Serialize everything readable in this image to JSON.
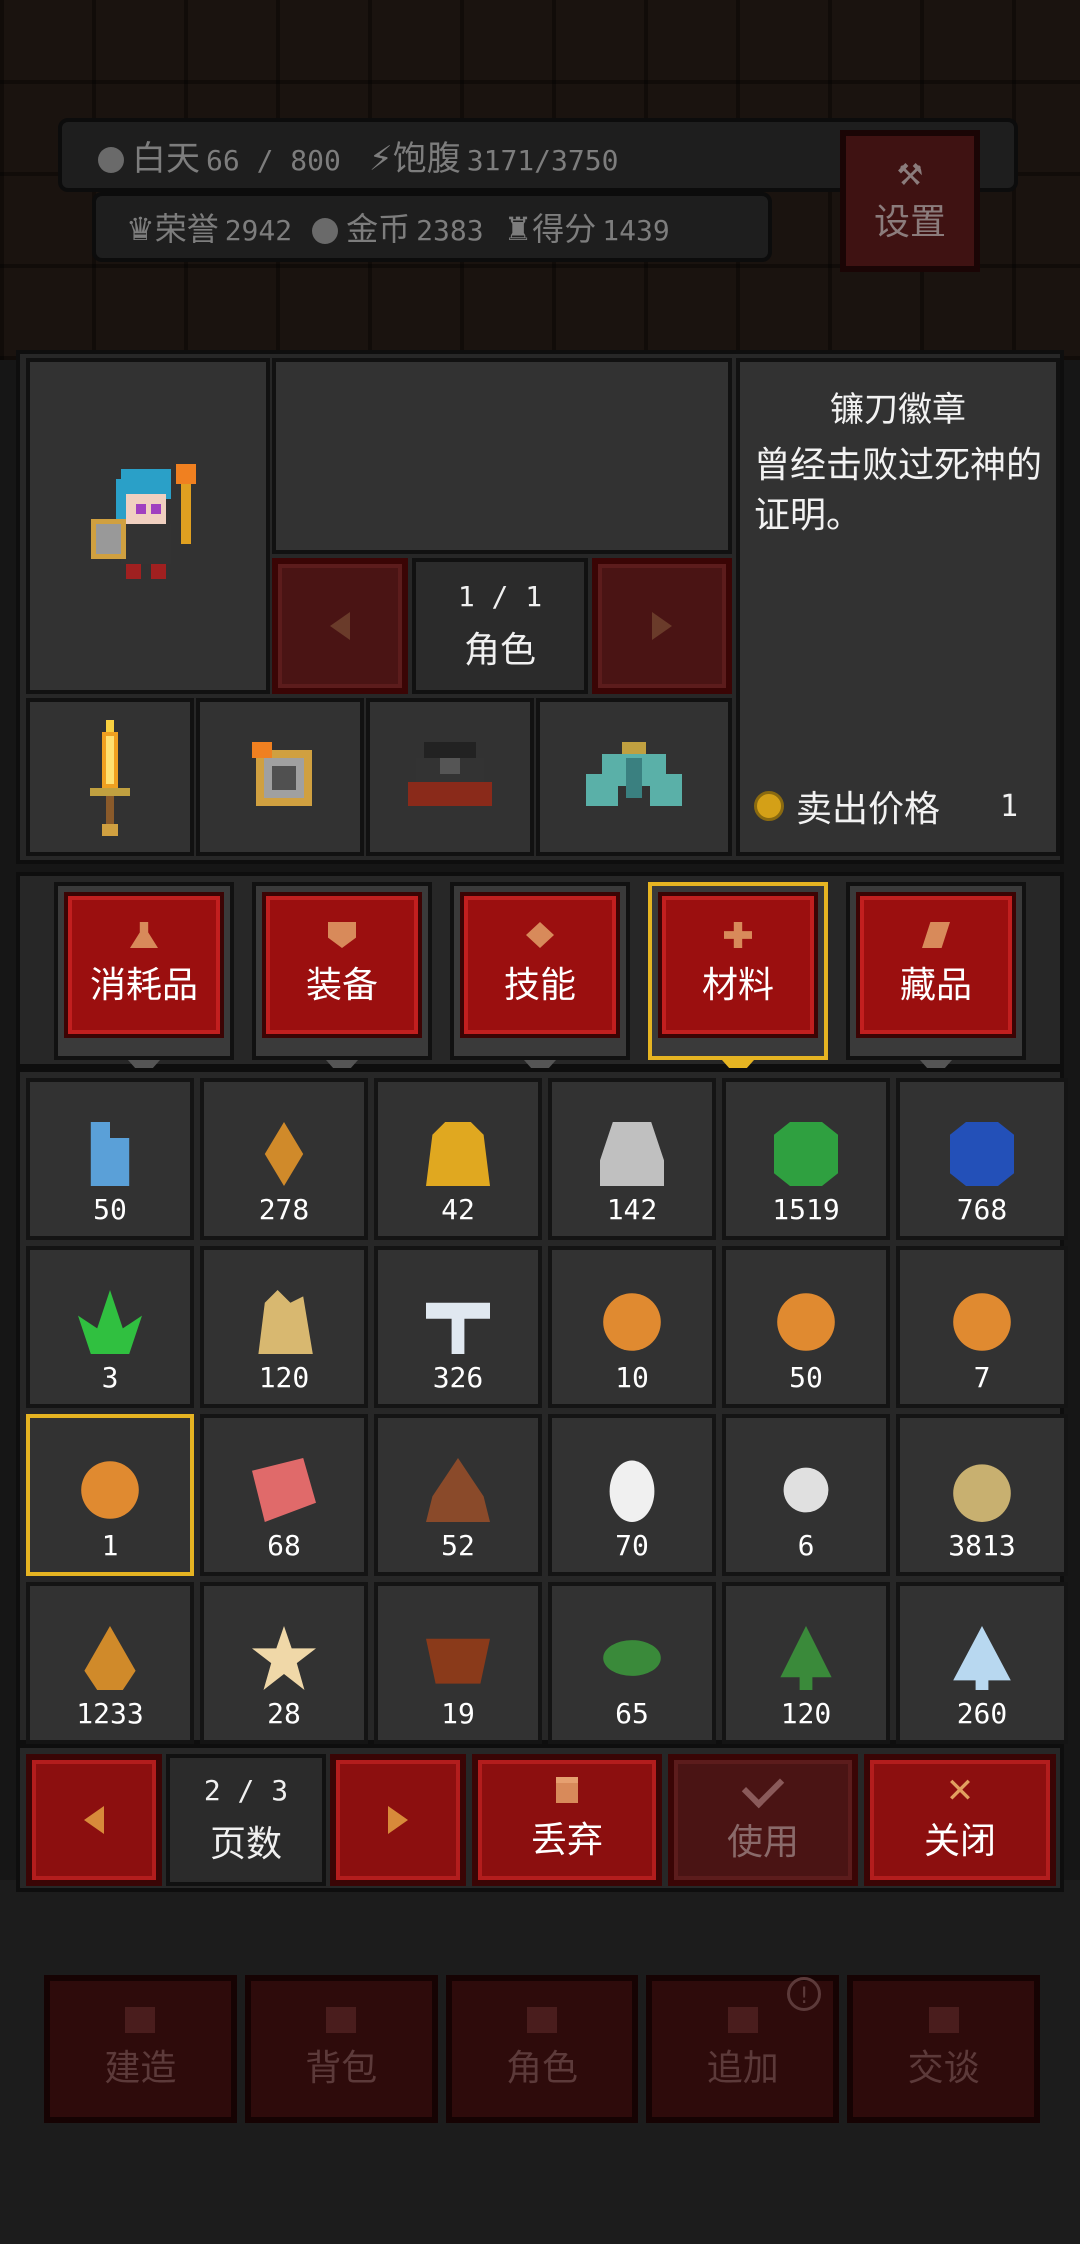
{
  "hud": {
    "day_label": "白天",
    "day_value": "66 / 800",
    "satiety_label": "饱腹",
    "satiety_value": "3171/3750",
    "honor_label": "荣誉",
    "honor_value": "2942",
    "gold_label": "金币",
    "gold_value": "2383",
    "score_label": "得分",
    "score_value": "1439",
    "settings_label": "设置"
  },
  "item_info": {
    "title": "镰刀徽章",
    "description": "曾经击败过死神的证明。",
    "sell_label": "卖出价格",
    "sell_value": "1"
  },
  "character_pager": {
    "page": "1 / 1",
    "label": "角色"
  },
  "equipment_slots": [
    {
      "icon": "flame-sword-icon"
    },
    {
      "icon": "tome-icon"
    },
    {
      "icon": "dark-armor-icon"
    },
    {
      "icon": "teal-cloak-icon"
    }
  ],
  "tabs": [
    {
      "label": "消耗品",
      "icon": "flask-icon",
      "active": false
    },
    {
      "label": "装备",
      "icon": "shield-icon",
      "active": false
    },
    {
      "label": "技能",
      "icon": "diamond-icon",
      "active": false
    },
    {
      "label": "材料",
      "icon": "cross-icon",
      "active": true
    },
    {
      "label": "藏品",
      "icon": "scroll-icon",
      "active": false
    }
  ],
  "inventory": [
    {
      "icon": "spray-bottle-icon",
      "qty": "50",
      "color": "#5aa0d8"
    },
    {
      "icon": "seed-icon",
      "qty": "278",
      "color": "#d08a2a"
    },
    {
      "icon": "gold-ingot-icon",
      "qty": "42",
      "color": "#e0a820"
    },
    {
      "icon": "silver-ore-icon",
      "qty": "142",
      "color": "#c0c0c0"
    },
    {
      "icon": "emerald-icon",
      "qty": "1519",
      "color": "#2fa040"
    },
    {
      "icon": "sapphire-icon",
      "qty": "768",
      "color": "#2350b8"
    },
    {
      "icon": "green-crystal-icon",
      "qty": "3",
      "color": "#30c040"
    },
    {
      "icon": "quartz-crystal-icon",
      "qty": "120",
      "color": "#d8b870"
    },
    {
      "icon": "mushroom-icon",
      "qty": "326",
      "color": "#e0e8f0"
    },
    {
      "icon": "orange-coin-icon",
      "qty": "10",
      "color": "#e08a30"
    },
    {
      "icon": "swirl-coin-icon",
      "qty": "50",
      "color": "#e08a30"
    },
    {
      "icon": "key-coin-icon",
      "qty": "7",
      "color": "#e08a30"
    },
    {
      "icon": "scythe-coin-icon",
      "qty": "1",
      "color": "#e08a30"
    },
    {
      "icon": "raw-meat-icon",
      "qty": "68",
      "color": "#e06a6a"
    },
    {
      "icon": "dung-icon",
      "qty": "52",
      "color": "#8a4a2a"
    },
    {
      "icon": "egg-icon",
      "qty": "70",
      "color": "#f0f0f0"
    },
    {
      "icon": "thread-icon",
      "qty": "6",
      "color": "#e0e0e0"
    },
    {
      "icon": "onion-icon",
      "qty": "3813",
      "color": "#c8b070"
    },
    {
      "icon": "amber-drop-icon",
      "qty": "1233",
      "color": "#d08a2a"
    },
    {
      "icon": "flower-icon",
      "qty": "28",
      "color": "#f0d8a8"
    },
    {
      "icon": "bowl-icon",
      "qty": "19",
      "color": "#8a3a1a"
    },
    {
      "icon": "leaf-icon",
      "qty": "65",
      "color": "#3a8a3a"
    },
    {
      "icon": "pine-tree-icon",
      "qty": "120",
      "color": "#3a8a3a"
    },
    {
      "icon": "snow-tree-icon",
      "qty": "260",
      "color": "#b8d8f0"
    }
  ],
  "inventory_pager": {
    "page": "2 / 3",
    "label": "页数"
  },
  "actions": {
    "discard": "丢弃",
    "use": "使用",
    "close": "关闭"
  },
  "bottom_nav": [
    {
      "label": "建造"
    },
    {
      "label": "背包"
    },
    {
      "label": "角色"
    },
    {
      "label": "追加",
      "badge": "!"
    },
    {
      "label": "交谈"
    }
  ]
}
